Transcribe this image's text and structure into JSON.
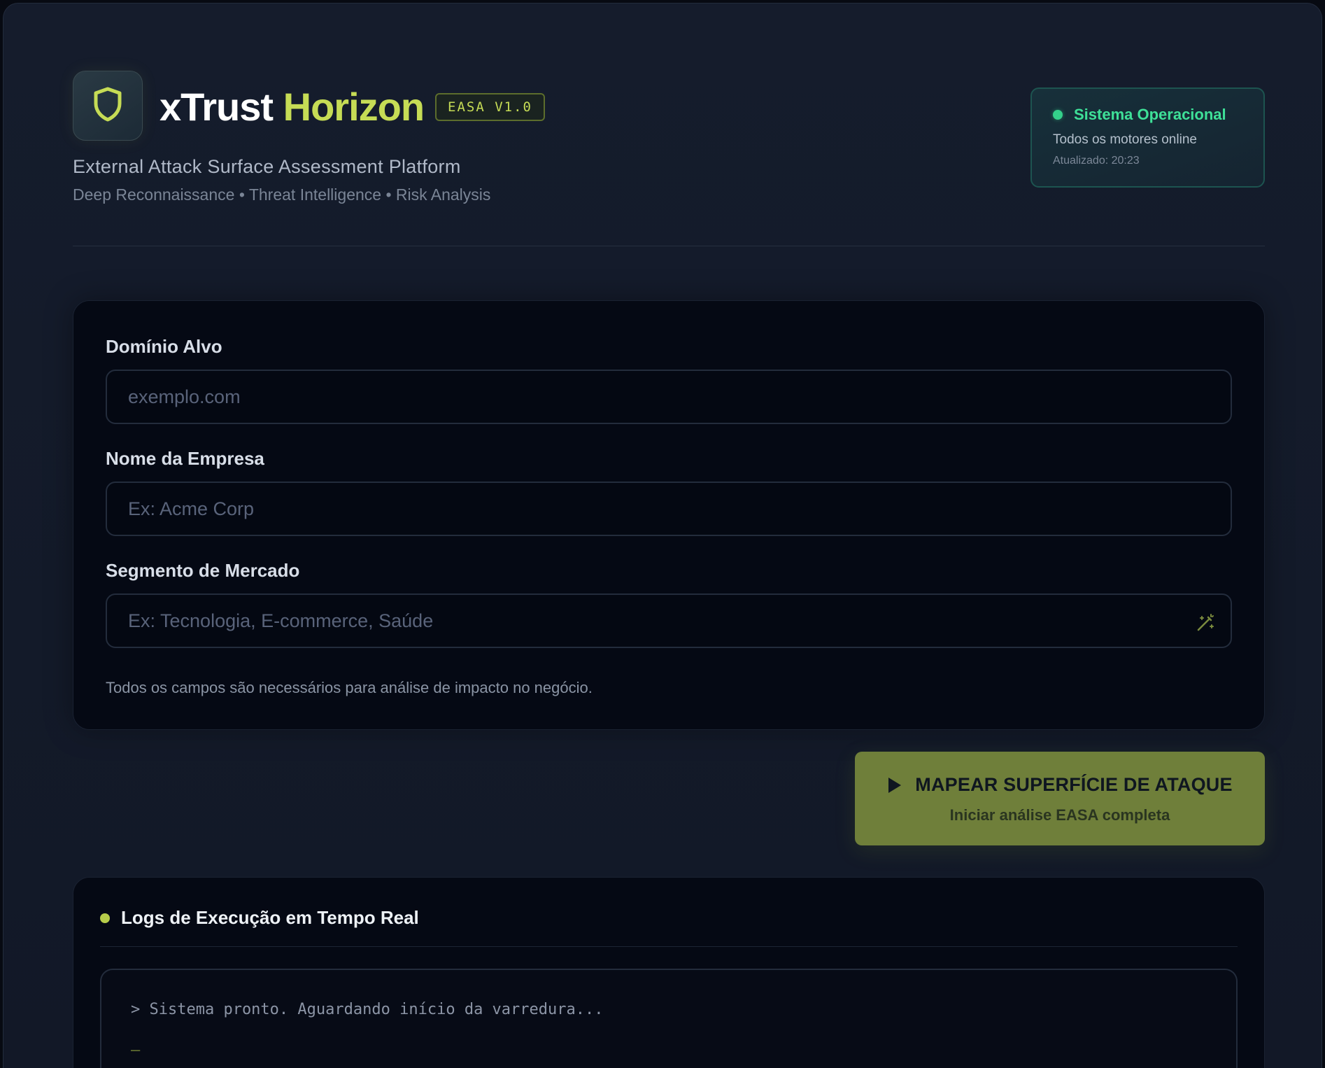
{
  "header": {
    "brand_primary": "xTrust",
    "brand_accent": "Horizon",
    "version": "EASA V1.0",
    "subtitle": "External Attack Surface Assessment Platform",
    "tagline": "Deep Reconnaissance • Threat Intelligence • Risk Analysis",
    "logo_icon": "shield-icon"
  },
  "status": {
    "title": "Sistema Operacional",
    "subtitle": "Todos os motores online",
    "updated": "Atualizado: 20:23",
    "color": "#34d08a"
  },
  "form": {
    "domain": {
      "label": "Domínio Alvo",
      "placeholder": "exemplo.com",
      "value": ""
    },
    "company": {
      "label": "Nome da Empresa",
      "placeholder": "Ex: Acme Corp",
      "value": ""
    },
    "segment": {
      "label": "Segmento de Mercado",
      "placeholder": "Ex: Tecnologia, E-commerce, Saúde",
      "value": "",
      "icon": "magic-wand-icon"
    },
    "helper": "Todos os campos são necessários para análise de impacto no negócio."
  },
  "cta": {
    "title": "MAPEAR SUPERFÍCIE DE ATAQUE",
    "subtitle": "Iniciar análise EASA completa",
    "icon": "play-icon"
  },
  "logs": {
    "title": "Logs de Execução em Tempo Real",
    "lines": [
      "> Sistema pronto. Aguardando início da varredura..."
    ],
    "cursor": "_"
  },
  "colors": {
    "accent": "#c6dc55",
    "background": "#131a29",
    "cta_background": "#6f7f3a"
  }
}
